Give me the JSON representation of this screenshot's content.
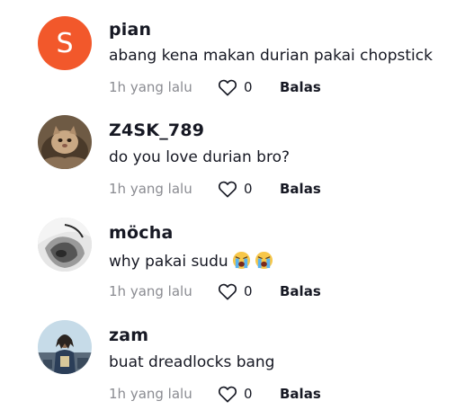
{
  "comments": [
    {
      "avatar_letter": "S",
      "avatar_color": "#f2582b",
      "username": "pian",
      "text": "abang kena makan durian pakai chopstick",
      "time": "1h yang lalu",
      "likes": "0",
      "reply_label": "Balas"
    },
    {
      "avatar_icon": "cat-photo-avatar",
      "username": "Z4SK_789",
      "text": "do you love durian bro?",
      "time": "1h yang lalu",
      "likes": "0",
      "reply_label": "Balas"
    },
    {
      "avatar_icon": "monochrome-photo-avatar",
      "username": "möcha",
      "text": "why pakai sudu",
      "text_emojis": [
        "loudly-crying-face-emoji",
        "loudly-crying-face-emoji"
      ],
      "time": "1h yang lalu",
      "likes": "0",
      "reply_label": "Balas"
    },
    {
      "avatar_icon": "person-photo-avatar",
      "username": "zam",
      "text": "buat dreadlocks bang",
      "time": "1h yang lalu",
      "likes": "0",
      "reply_label": "Balas"
    }
  ],
  "colors": {
    "text_primary": "#161823",
    "text_secondary": "#8a8b91"
  }
}
